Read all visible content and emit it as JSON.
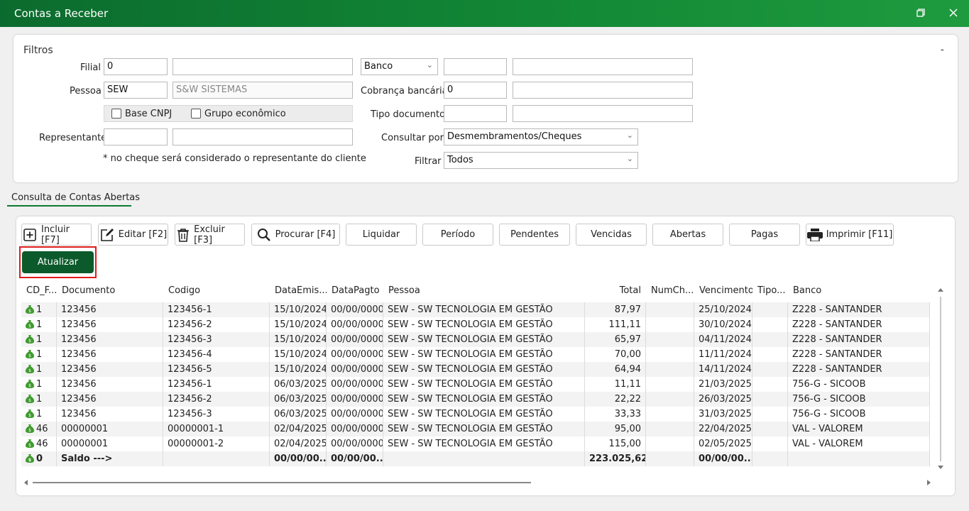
{
  "window": {
    "title": "Contas a Receber",
    "restore_icon": "restore-icon",
    "close_icon": "close-icon"
  },
  "filters": {
    "title": "Filtros",
    "collapse": "-",
    "filial_label": "Filial",
    "filial_value": "0",
    "filial_name": "",
    "banco_label": "Banco",
    "banco_code": "",
    "banco_name": "",
    "pessoa_label": "Pessoa",
    "pessoa_value": "SEW",
    "pessoa_name": "S&W SISTEMAS",
    "cobranca_label": "Cobrança bancária",
    "cobranca_value": "0",
    "cobranca_name": "",
    "base_cnpj_label": "Base CNPJ",
    "grupo_label": "Grupo econômico",
    "tipo_doc_label": "Tipo documento",
    "tipo_doc_code": "",
    "tipo_doc_name": "",
    "representante_label": "Representante",
    "representante_code": "",
    "representante_name": "",
    "consultar_label": "Consultar por",
    "consultar_value": "Desmembramentos/Cheques",
    "note": "* no cheque será considerado o representante do cliente",
    "filtrar_label": "Filtrar",
    "filtrar_value": "Todos"
  },
  "tab": {
    "label": "Consulta de Contas Abertas"
  },
  "toolbar": {
    "incluir": "Incluir [F7]",
    "editar": "Editar [F2]",
    "excluir": "Excluir [F3]",
    "procurar": "Procurar [F4]",
    "liquidar": "Liquidar",
    "periodo": "Período",
    "pendentes": "Pendentes",
    "vencidas": "Vencidas",
    "abertas": "Abertas",
    "pagas": "Pagas",
    "imprimir": "Imprimir [F11]",
    "atualizar": "Atualizar"
  },
  "grid": {
    "columns": [
      "CD_F...",
      "Documento",
      "Codigo",
      "DataEmis...",
      "DataPagto",
      "Pessoa",
      "Total",
      "NumCh...",
      "Vencimento",
      "Tipo...",
      "Banco"
    ],
    "rows": [
      [
        "1",
        "123456",
        "123456-1",
        "15/10/2024",
        "00/00/0000",
        "SEW - SW TECNOLOGIA EM GESTÃO",
        "87,97",
        "",
        "25/10/2024",
        "",
        "Z228 - SANTANDER"
      ],
      [
        "1",
        "123456",
        "123456-2",
        "15/10/2024",
        "00/00/0000",
        "SEW - SW TECNOLOGIA EM GESTÃO",
        "111,11",
        "",
        "30/10/2024",
        "",
        "Z228 - SANTANDER"
      ],
      [
        "1",
        "123456",
        "123456-3",
        "15/10/2024",
        "00/00/0000",
        "SEW - SW TECNOLOGIA EM GESTÃO",
        "65,97",
        "",
        "04/11/2024",
        "",
        "Z228 - SANTANDER"
      ],
      [
        "1",
        "123456",
        "123456-4",
        "15/10/2024",
        "00/00/0000",
        "SEW - SW TECNOLOGIA EM GESTÃO",
        "70,00",
        "",
        "11/11/2024",
        "",
        "Z228 - SANTANDER"
      ],
      [
        "1",
        "123456",
        "123456-5",
        "15/10/2024",
        "00/00/0000",
        "SEW - SW TECNOLOGIA EM GESTÃO",
        "64,94",
        "",
        "14/11/2024",
        "",
        "Z228 - SANTANDER"
      ],
      [
        "1",
        "123456",
        "123456-1",
        "06/03/2025",
        "00/00/0000",
        "SEW - SW TECNOLOGIA EM GESTÃO",
        "11,11",
        "",
        "21/03/2025",
        "",
        "756-G - SICOOB"
      ],
      [
        "1",
        "123456",
        "123456-2",
        "06/03/2025",
        "00/00/0000",
        "SEW - SW TECNOLOGIA EM GESTÃO",
        "22,22",
        "",
        "26/03/2025",
        "",
        "756-G - SICOOB"
      ],
      [
        "1",
        "123456",
        "123456-3",
        "06/03/2025",
        "00/00/0000",
        "SEW - SW TECNOLOGIA EM GESTÃO",
        "33,33",
        "",
        "31/03/2025",
        "",
        "756-G - SICOOB"
      ],
      [
        "46",
        "00000001",
        "00000001-1",
        "02/04/2025",
        "00/00/0000",
        "SEW - SW TECNOLOGIA EM GESTÃO",
        "95,00",
        "",
        "22/04/2025",
        "",
        "VAL - VALOREM"
      ],
      [
        "46",
        "00000001",
        "00000001-2",
        "02/04/2025",
        "00/00/0000",
        "SEW - SW TECNOLOGIA EM GESTÃO",
        "115,00",
        "",
        "02/05/2025",
        "",
        "VAL - VALOREM"
      ],
      [
        "0",
        "Saldo --->",
        "",
        "00/00/00...",
        "00/00/00...",
        "",
        "223.025,62",
        "",
        "00/00/00...",
        "",
        ""
      ]
    ]
  },
  "colors": {
    "titlebar": "#0b6b2e",
    "accent": "#0c5a2b",
    "highlight": "#e01b1b",
    "money_icon": "#3f9a2e"
  }
}
